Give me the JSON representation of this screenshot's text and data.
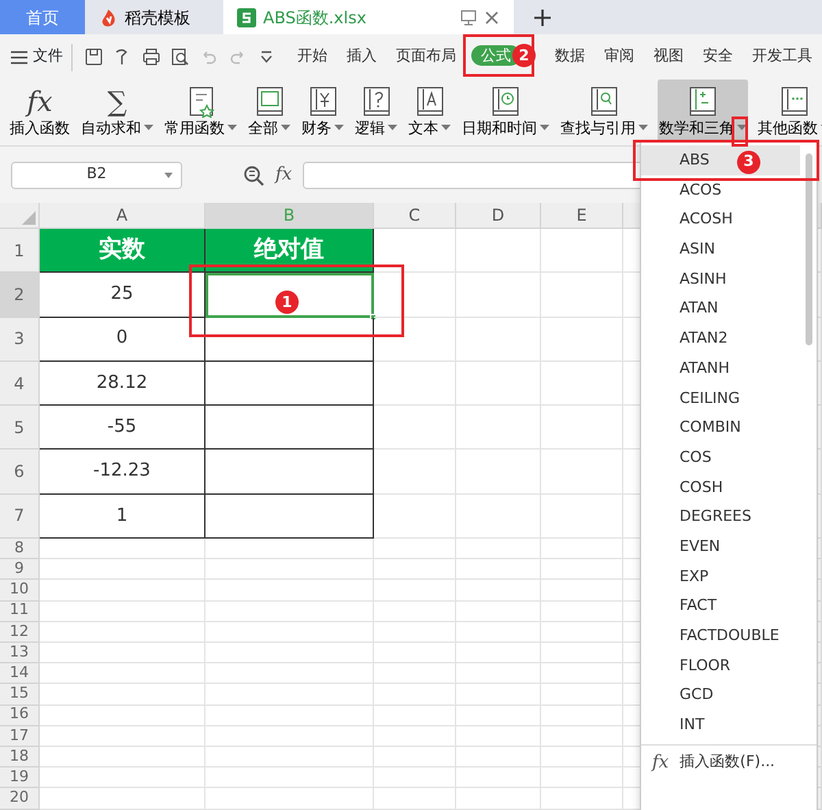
{
  "tabs": [
    {
      "label": "首页",
      "kind": "home",
      "selected": false
    },
    {
      "label": "稻壳模板",
      "kind": "docer",
      "selected": false
    },
    {
      "label": "ABS函数.xlsx",
      "kind": "file",
      "selected": true
    }
  ],
  "menu": {
    "file": "文件",
    "tabs": [
      {
        "label": "开始",
        "selected": false
      },
      {
        "label": "插入",
        "selected": false
      },
      {
        "label": "页面布局",
        "selected": false
      },
      {
        "label": "公式",
        "selected": true,
        "callout": "2"
      },
      {
        "label": "数据",
        "selected": false
      },
      {
        "label": "审阅",
        "selected": false
      },
      {
        "label": "视图",
        "selected": false
      },
      {
        "label": "安全",
        "selected": false
      },
      {
        "label": "开发工具",
        "selected": false
      }
    ]
  },
  "ribbon": [
    {
      "label": "插入函数",
      "glyph": "fx",
      "dropdown": false,
      "active": false,
      "highlighted": false
    },
    {
      "label": "自动求和",
      "glyph": "∑",
      "dropdown": true,
      "active": false,
      "highlighted": false
    },
    {
      "label": "常用函数",
      "dropdown": true,
      "active": false,
      "highlighted": false
    },
    {
      "label": "全部",
      "dropdown": true,
      "active": false,
      "highlighted": false
    },
    {
      "label": "财务",
      "dropdown": true,
      "active": false,
      "highlighted": false
    },
    {
      "label": "逻辑",
      "dropdown": true,
      "active": false,
      "highlighted": false
    },
    {
      "label": "文本",
      "dropdown": true,
      "active": false,
      "highlighted": false
    },
    {
      "label": "日期和时间",
      "dropdown": true,
      "active": false,
      "highlighted": false
    },
    {
      "label": "查找与引用",
      "dropdown": true,
      "active": false,
      "highlighted": false
    },
    {
      "label": "数学和三角",
      "dropdown": true,
      "active": true,
      "highlighted": true
    },
    {
      "label": "其他函数",
      "dropdown": true,
      "active": false,
      "highlighted": false
    }
  ],
  "formula_bar": {
    "name_box": "B2",
    "fx": "fx"
  },
  "columns": [
    {
      "label": "A",
      "selected": false
    },
    {
      "label": "B",
      "selected": true
    },
    {
      "label": "C",
      "selected": false
    },
    {
      "label": "D",
      "selected": false
    },
    {
      "label": "E",
      "selected": false
    }
  ],
  "rows": [
    {
      "header": "1",
      "kind": "heading",
      "selected": false,
      "a": "实数",
      "b": "绝对值"
    },
    {
      "header": "2",
      "kind": "data",
      "selected": true,
      "a": "25",
      "callout": "1"
    },
    {
      "header": "3",
      "kind": "data",
      "selected": false,
      "a": "0"
    },
    {
      "header": "4",
      "kind": "data",
      "selected": false,
      "a": "28.12"
    },
    {
      "header": "5",
      "kind": "data",
      "selected": false,
      "a": "-55"
    },
    {
      "header": "6",
      "kind": "data",
      "selected": false,
      "a": "-12.23"
    },
    {
      "header": "7",
      "kind": "data",
      "selected": false,
      "a": "1"
    },
    {
      "header": "8",
      "kind": "blank",
      "selected": false
    },
    {
      "header": "9",
      "kind": "blank",
      "selected": false
    },
    {
      "header": "10",
      "kind": "blank",
      "selected": false
    },
    {
      "header": "11",
      "kind": "blank",
      "selected": false
    },
    {
      "header": "12",
      "kind": "blank",
      "selected": false
    },
    {
      "header": "13",
      "kind": "blank",
      "selected": false
    },
    {
      "header": "14",
      "kind": "blank",
      "selected": false
    },
    {
      "header": "15",
      "kind": "blank",
      "selected": false
    },
    {
      "header": "16",
      "kind": "blank",
      "selected": false
    },
    {
      "header": "17",
      "kind": "blank",
      "selected": false
    },
    {
      "header": "18",
      "kind": "blank",
      "selected": false
    },
    {
      "header": "19",
      "kind": "blank",
      "selected": false
    },
    {
      "header": "20",
      "kind": "blank",
      "selected": false
    }
  ],
  "dropdown": {
    "items": [
      {
        "label": "ABS",
        "selected": true,
        "callout": "3"
      },
      {
        "label": "ACOS",
        "selected": false
      },
      {
        "label": "ACOSH",
        "selected": false
      },
      {
        "label": "ASIN",
        "selected": false
      },
      {
        "label": "ASINH",
        "selected": false
      },
      {
        "label": "ATAN",
        "selected": false
      },
      {
        "label": "ATAN2",
        "selected": false
      },
      {
        "label": "ATANH",
        "selected": false
      },
      {
        "label": "CEILING",
        "selected": false
      },
      {
        "label": "COMBIN",
        "selected": false
      },
      {
        "label": "COS",
        "selected": false
      },
      {
        "label": "COSH",
        "selected": false
      },
      {
        "label": "DEGREES",
        "selected": false
      },
      {
        "label": "EVEN",
        "selected": false
      },
      {
        "label": "EXP",
        "selected": false
      },
      {
        "label": "FACT",
        "selected": false
      },
      {
        "label": "FACTDOUBLE",
        "selected": false
      },
      {
        "label": "FLOOR",
        "selected": false
      },
      {
        "label": "GCD",
        "selected": false
      },
      {
        "label": "INT",
        "selected": false
      }
    ],
    "footer_glyph": "fx",
    "footer": "插入函数(F)..."
  }
}
